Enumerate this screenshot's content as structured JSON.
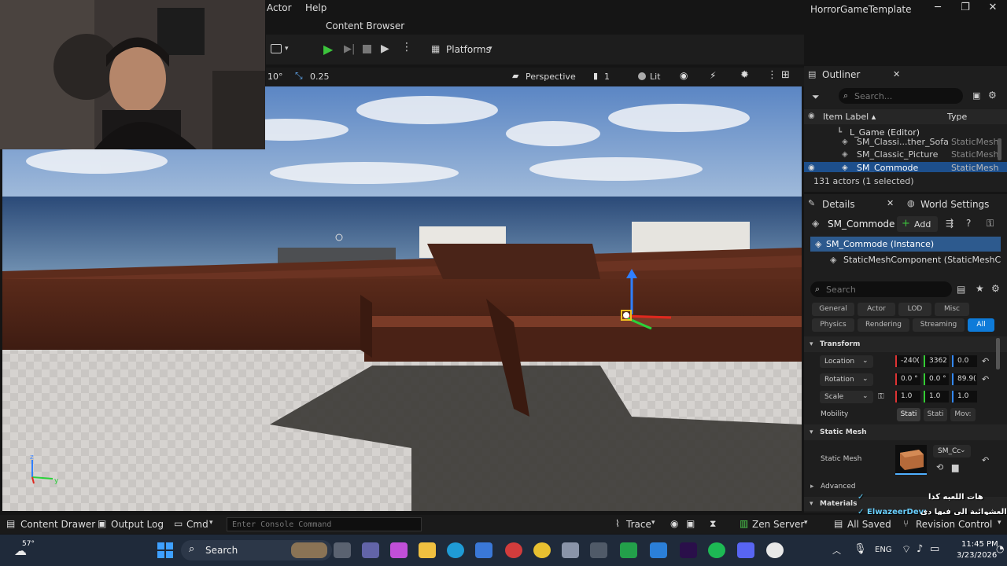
{
  "menu": {
    "actor": "Actor",
    "help": "Help"
  },
  "window": {
    "title": "HorrorGameTemplate",
    "minimize": "─",
    "maximize": "❐",
    "close": "✕"
  },
  "tabs": {
    "content_browser": "Content Browser"
  },
  "toolbar": {
    "platforms": "Platforms"
  },
  "viewport_bar": {
    "rotation_snap": "10°",
    "scale_snap": "0.25",
    "perspective": "Perspective",
    "camera_speed": "1",
    "lit": "Lit"
  },
  "outliner": {
    "title": "Outliner",
    "search_placeholder": "Search...",
    "col_item_label": "Item Label ▴",
    "col_type": "Type",
    "rows": [
      {
        "label": "L_Game (Editor)",
        "type": ""
      },
      {
        "label": "SM_Classi...ther_Sofa",
        "type": "StaticMesh"
      },
      {
        "label": "SM_Classic_Picture",
        "type": "StaticMesh"
      },
      {
        "label": "SM_Commode",
        "type": "StaticMesh"
      }
    ],
    "actor_count": "131 actors (1 selected)"
  },
  "details": {
    "tab_details": "Details",
    "tab_world_settings": "World Settings",
    "actor_name": "SM_Commode",
    "add_button": "Add",
    "instance_label": "SM_Commode (Instance)",
    "component_label": "StaticMeshComponent (StaticMeshCo",
    "search_placeholder": "Search",
    "filter_chips": [
      "General",
      "Actor",
      "LOD",
      "Misc",
      "Physics",
      "Rendering",
      "Streaming",
      "All"
    ],
    "transform": {
      "section": "Transform",
      "location_label": "Location",
      "location": [
        "-240(",
        "3362",
        "0.0"
      ],
      "rotation_label": "Rotation",
      "rotation": [
        "0.0 °",
        "0.0 °",
        "89.9("
      ],
      "scale_label": "Scale",
      "scale": [
        "1.0",
        "1.0",
        "1.0"
      ],
      "mobility_label": "Mobility",
      "mobility": [
        "Stati",
        "Stati",
        "Mov:"
      ]
    },
    "static_mesh": {
      "section": "Static Mesh",
      "label": "Static Mesh",
      "value": "SM_Cc"
    },
    "advanced": "Advanced",
    "materials": "Materials"
  },
  "bottom_bar": {
    "content_drawer": "Content Drawer",
    "output_log": "Output Log",
    "cmd": "Cmd",
    "console_placeholder": "Enter Console Command",
    "trace": "Trace",
    "zen_server": "Zen Server",
    "all_saved": "All Saved",
    "revision_control": "Revision Control"
  },
  "chat": {
    "line1": "هات اللعبه كدا",
    "line2_user": "ElwazeerDev:",
    "line2_text": "ه يقول ايه العشوائية الي فيها دي"
  },
  "taskbar": {
    "weather": "57°",
    "search": "Search",
    "lang": "ENG",
    "time": "11:45 PM",
    "date": "3/23/2026"
  },
  "colors": {
    "accent": "#0e7bd9",
    "bg": "#151515",
    "panel": "#1e1e1e"
  }
}
